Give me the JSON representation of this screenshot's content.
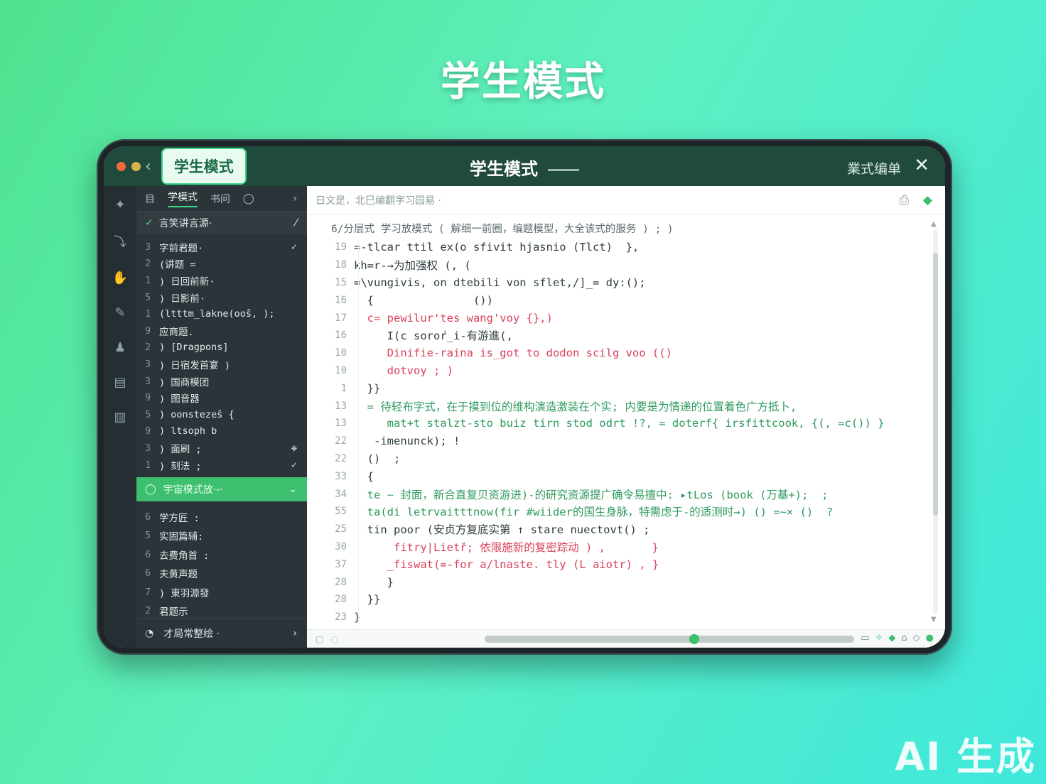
{
  "page": {
    "hero_title": "学生模式",
    "watermark": "AI 生成"
  },
  "window": {
    "mode_tab": "学生模式",
    "title": "学生模式",
    "right_label": "業式编单",
    "colors": {
      "dot_red": "#f06a3a",
      "dot_yellow": "#d9b34a",
      "dot_green": "#6fbf7f",
      "accent": "#3cbf6e",
      "titlebar": "#1f4a3c"
    }
  },
  "rail": {
    "icons": [
      "spark-icon",
      "path-icon",
      "hand-icon",
      "pen-icon",
      "person-icon",
      "document-icon",
      "book-icon"
    ]
  },
  "sidebar": {
    "header_tabs": [
      "目",
      "学模式",
      "书问"
    ],
    "sub_header": "言笑讲言源·",
    "items": [
      {
        "num": "3",
        "text": "字前君题·",
        "mark": "✓"
      },
      {
        "num": "2",
        "text": "(讲题 =",
        "mark": ""
      },
      {
        "num": "1",
        "text": ") 日回前新·",
        "mark": ""
      },
      {
        "num": "5",
        "text": ") 日影前·",
        "mark": ""
      },
      {
        "num": "1",
        "text": "(ltttm_lakne(ooŝ, );",
        "mark": ""
      },
      {
        "num": "9",
        "text": "应商题.",
        "mark": ""
      },
      {
        "num": "2",
        "text": ") [Dragpons]",
        "mark": ""
      },
      {
        "num": "3",
        "text": ") 日宿发首宴 )",
        "mark": ""
      },
      {
        "num": "3",
        "text": ") 国商模团",
        "mark": ""
      },
      {
        "num": "9",
        "text": ") 图音器",
        "mark": ""
      },
      {
        "num": "5",
        "text": ") oonstezeŝ {",
        "mark": ""
      },
      {
        "num": "9",
        "text": ") ltsoph b",
        "mark": ""
      },
      {
        "num": "3",
        "text": ") 面刷 ;",
        "mark": "✥"
      },
      {
        "num": "1",
        "text": ") 刻法 ;",
        "mark": "✓"
      }
    ],
    "active_item": "宇宙模式放·-·",
    "items2": [
      {
        "num": "6",
        "text": "学方匠 :"
      },
      {
        "num": "5",
        "text": "实固篇辅:"
      },
      {
        "num": "6",
        "text": "去费角首 :"
      },
      {
        "num": "6",
        "text": "夫黄声题"
      },
      {
        "num": "7",
        "text": ") 東羽源發"
      },
      {
        "num": "2",
        "text": "君题示"
      }
    ],
    "footer": "才局常整绘 ·"
  },
  "editor": {
    "breadcrumb": "日文是，北巳编翻字习园易 ·",
    "comment": "6/分层式 学习放模式 ( 解细一前圈，编题模型，大全该式的服务 ) ; )",
    "lines": [
      {
        "n": "19",
        "t": "=-tlcar ttil ex(o sfivit hjasnio (Tlct)  },",
        "c": ""
      },
      {
        "n": "18",
        "t": "kh=r-→为加强权 (, (",
        "c": ""
      },
      {
        "n": "15",
        "t": "=\\vungivis, on dtebili von sflet,/]_= dy:();",
        "c": ""
      },
      {
        "n": "16",
        "t": "  {               ())",
        "c": ""
      },
      {
        "n": "17",
        "t": "  c= pewilur'tes wang'voy {},)",
        "c": "red"
      },
      {
        "n": "16",
        "t": "     I(c soroŕ_i-有游進(,",
        "c": ""
      },
      {
        "n": "10",
        "t": "     Dinifie-raina is_got to dodon scilg voo (()",
        "c": "red"
      },
      {
        "n": "10",
        "t": "     dotvoy ; )",
        "c": "red"
      },
      {
        "n": "1",
        "t": "  }}",
        "c": ""
      },
      {
        "n": "13",
        "t": "  = 待轻布字式，在于摸到位的维构演造激装在个实; 内要是为情递的位置着色广方抵卜,",
        "c": "green"
      },
      {
        "n": "13",
        "t": "     mat+t stalzt-sto buiz tirn stod odrt !?, = doterf{ irsfittcook, {(, =c()) }",
        "c": "green"
      },
      {
        "n": "22",
        "t": "   -imenunck); !",
        "c": ""
      },
      {
        "n": "22",
        "t": "  ()  ;",
        "c": ""
      },
      {
        "n": "33",
        "t": "  {",
        "c": ""
      },
      {
        "n": "34",
        "t": "  te ~ 封面，新合直复贝资游进)-的研究资源提广确令易擅中: ▸tLos (book (万基+);  ;",
        "c": "green"
      },
      {
        "n": "55",
        "t": "  ta(di letrvaitttnow(fir #wiider的国生身脉，特需虑于-的适测时→) () =~× ()  ?",
        "c": "green"
      },
      {
        "n": "25",
        "t": "  tin poor (安贞方复底实第 ↑ stare nuectovt() ;",
        "c": ""
      },
      {
        "n": "30",
        "t": "      fitry|Lietř; 依限施新的复密踪动 ) ,       }",
        "c": "red"
      },
      {
        "n": "37",
        "t": "     _fiswat(=-for a/lnaste. tly (L aiotr) , }",
        "c": "red"
      },
      {
        "n": "28",
        "t": "     }",
        "c": ""
      },
      {
        "n": "28",
        "t": "  }}",
        "c": ""
      },
      {
        "n": "23",
        "t": "}",
        "c": ""
      }
    ]
  }
}
